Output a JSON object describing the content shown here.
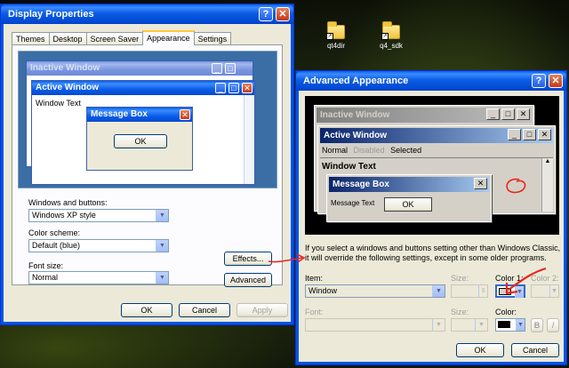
{
  "desktop": {
    "icons": [
      {
        "label": "qt4dir"
      },
      {
        "label": "q4_sdk"
      }
    ]
  },
  "display_properties": {
    "title": "Display Properties",
    "help_glyph": "?",
    "close_glyph": "✕",
    "tabs": [
      "Themes",
      "Desktop",
      "Screen Saver",
      "Appearance",
      "Settings"
    ],
    "preview": {
      "inactive_title": "Inactive Window",
      "active_title": "Active Window",
      "window_text": "Window Text",
      "message_box_title": "Message Box",
      "ok_label": "OK"
    },
    "windows_and_buttons_label": "Windows and buttons:",
    "windows_and_buttons_value": "Windows XP style",
    "color_scheme_label": "Color scheme:",
    "color_scheme_value": "Default (blue)",
    "font_size_label": "Font size:",
    "font_size_value": "Normal",
    "effects_label": "Effects...",
    "advanced_label": "Advanced",
    "ok_label": "OK",
    "cancel_label": "Cancel",
    "apply_label": "Apply"
  },
  "advanced_appearance": {
    "title": "Advanced Appearance",
    "help_glyph": "?",
    "close_glyph": "✕",
    "preview": {
      "inactive_title": "Inactive Window",
      "active_title": "Active Window",
      "menu_normal": "Normal",
      "menu_disabled": "Disabled",
      "menu_selected": "Selected",
      "window_text": "Window Text",
      "message_box_title": "Message Box",
      "message_text": "Message Text",
      "ok_label": "OK"
    },
    "info_text": "If you select a windows and buttons setting other than Windows Classic, it will override the following settings, except in some older programs.",
    "item_label": "Item:",
    "item_value": "Window",
    "size_label": "Size:",
    "color1_label": "Color 1:",
    "color2_label": "Color 2:",
    "font_label": "Font:",
    "font_size_label": "Size:",
    "font_color_label": "Color:",
    "bold_label": "B",
    "italic_label": "I",
    "ok_label": "OK",
    "cancel_label": "Cancel"
  },
  "colors": {
    "xp_title_blue": "#0049d2",
    "dialog_bg": "#ece9d8",
    "annotation_red": "#e8261c",
    "preview_desktop": "#000000"
  }
}
